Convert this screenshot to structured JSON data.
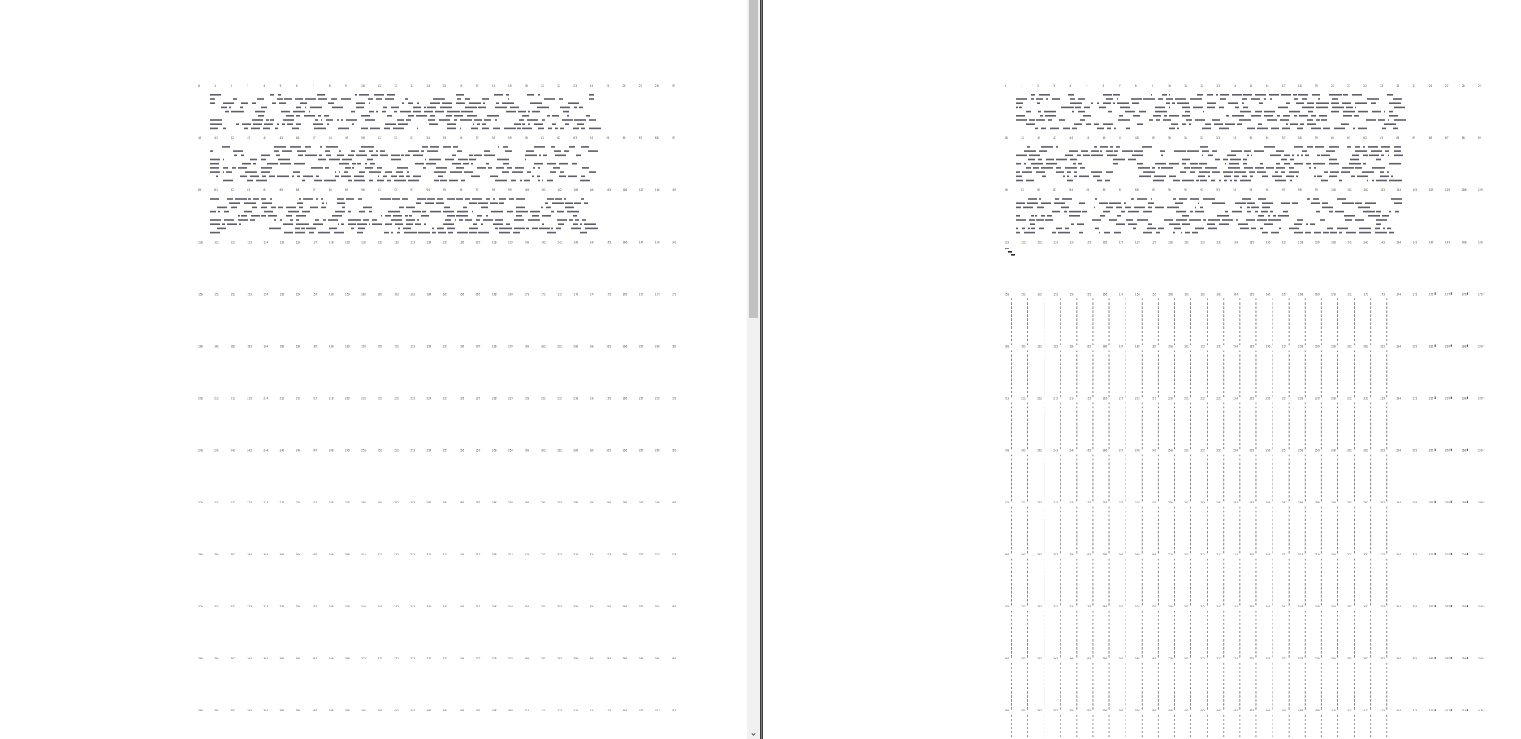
{
  "left_pane": {
    "rows": [
      {
        "type": "art",
        "first": 0
      },
      {
        "type": "art",
        "first": 40
      },
      {
        "type": "art",
        "first": 80
      },
      {
        "type": "plain",
        "first": 120
      },
      {
        "type": "plain",
        "first": 150
      },
      {
        "type": "plain",
        "first": 180
      },
      {
        "type": "plain",
        "first": 210
      },
      {
        "type": "plain",
        "first": 240
      },
      {
        "type": "plain",
        "first": 270
      },
      {
        "type": "plain",
        "first": 300
      },
      {
        "type": "plain",
        "first": 330
      },
      {
        "type": "plain",
        "first": 360
      },
      {
        "type": "plain",
        "first": 390
      }
    ]
  },
  "right_pane": {
    "rows": [
      {
        "type": "art",
        "first": 0
      },
      {
        "type": "art",
        "first": 40
      },
      {
        "type": "art",
        "first": 80
      },
      {
        "type": "plain",
        "first": 120
      },
      {
        "type": "columns",
        "first": 150
      },
      {
        "type": "columns",
        "first": 180
      },
      {
        "type": "columns",
        "first": 210
      },
      {
        "type": "columns",
        "first": 240
      },
      {
        "type": "columns",
        "first": 270
      },
      {
        "type": "columns",
        "first": 300
      },
      {
        "type": "columns",
        "first": 330
      },
      {
        "type": "columns",
        "first": 360
      },
      {
        "type": "columns",
        "first": 390
      }
    ]
  },
  "scrollbar": {
    "down_arrow": "⌄"
  },
  "colors": {
    "text": "#555555",
    "ink": "#2a2a3a",
    "background": "#ffffff",
    "divider": "#3c3c3c",
    "scroll_track": "#f1f1f1",
    "scroll_thumb": "#c1c1c1"
  }
}
